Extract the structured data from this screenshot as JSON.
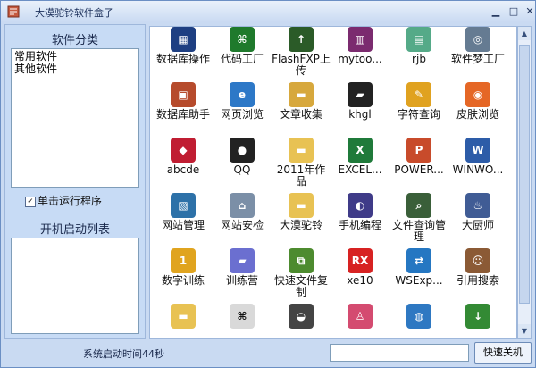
{
  "window": {
    "title": "大漠驼铃软件盒子"
  },
  "left_panel": {
    "category_title": "软件分类",
    "categories": [
      "常用软件",
      "其他软件"
    ],
    "run_on_click_label": "单击运行程序",
    "run_on_click_checked": true,
    "startup_title": "开机启动列表"
  },
  "apps": [
    {
      "label": "数据库操作",
      "icon": "database-icon",
      "color": "#1e3f82"
    },
    {
      "label": "代码工厂",
      "icon": "code-book-icon",
      "color": "#1f7a2c"
    },
    {
      "label": "FlashFXP上传",
      "icon": "flashfxp-icon",
      "color": "#2b5b28"
    },
    {
      "label": "mytoo...",
      "icon": "books-icon",
      "color": "#7b2b6f"
    },
    {
      "label": "rjb",
      "icon": "pages-icon",
      "color": "#55aa88"
    },
    {
      "label": "软件梦工厂",
      "icon": "satellite-icon",
      "color": "#657b92"
    },
    {
      "label": "数据库助手",
      "icon": "database-helper-icon",
      "color": "#b64b2c"
    },
    {
      "label": "网页浏览",
      "icon": "browser-icon",
      "color": "#2d78c7"
    },
    {
      "label": "文章收集",
      "icon": "folder-icon",
      "color": "#d7a83d"
    },
    {
      "label": "khgl",
      "icon": "car-icon",
      "color": "#222222"
    },
    {
      "label": "字符查询",
      "icon": "pen-icon",
      "color": "#e0a220"
    },
    {
      "label": "皮肤浏览",
      "icon": "skin-icon",
      "color": "#e56726"
    },
    {
      "label": "abcde",
      "icon": "red-gem-icon",
      "color": "#c01d32"
    },
    {
      "label": "QQ",
      "icon": "qq-penguin-icon",
      "color": "#222222"
    },
    {
      "label": "2011年作品",
      "icon": "folder-icon",
      "color": "#e8c253"
    },
    {
      "label": "EXCEL...",
      "icon": "excel-icon",
      "color": "#1f7a3a"
    },
    {
      "label": "POWER...",
      "icon": "powerpoint-icon",
      "color": "#c84b2b"
    },
    {
      "label": "WINWO...",
      "icon": "word-icon",
      "color": "#2d5ca8"
    },
    {
      "label": "网站管理",
      "icon": "website-manage-icon",
      "color": "#2d71a8"
    },
    {
      "label": "网站安检",
      "icon": "website-check-icon",
      "color": "#7b8fa7"
    },
    {
      "label": "大漠驼铃",
      "icon": "folder-icon",
      "color": "#e8c253"
    },
    {
      "label": "手机编程",
      "icon": "eclipse-icon",
      "color": "#3f3b88"
    },
    {
      "label": "文件查询管理",
      "icon": "search-file-icon",
      "color": "#3a5f39"
    },
    {
      "label": "大厨师",
      "icon": "chef-icon",
      "color": "#405c95"
    },
    {
      "label": "数字训练",
      "icon": "number-medal-icon",
      "color": "#e0a41f"
    },
    {
      "label": "训练营",
      "icon": "car-icon",
      "color": "#6b6fd0"
    },
    {
      "label": "快速文件复制",
      "icon": "copy-icon",
      "color": "#4d8b2f"
    },
    {
      "label": "xe10",
      "icon": "rx-icon",
      "color": "#d72222"
    },
    {
      "label": "WSExp...",
      "icon": "network-icon",
      "color": "#2577c2"
    },
    {
      "label": "引用搜索",
      "icon": "bear-icon",
      "color": "#8b5a35"
    },
    {
      "label": "",
      "icon": "folder-icon",
      "color": "#e8c253"
    },
    {
      "label": "",
      "icon": "cursor-icon",
      "color": "#d9d9d9"
    },
    {
      "label": "",
      "icon": "panda-icon",
      "color": "#444444"
    },
    {
      "label": "",
      "icon": "person-icon",
      "color": "#d44b70"
    },
    {
      "label": "",
      "icon": "globe-icon",
      "color": "#2e78c2"
    },
    {
      "label": "",
      "icon": "download-icon",
      "color": "#338a34"
    }
  ],
  "statusbar": {
    "startup_time": "系统启动时间44秒",
    "shutdown_label": "快速关机"
  }
}
